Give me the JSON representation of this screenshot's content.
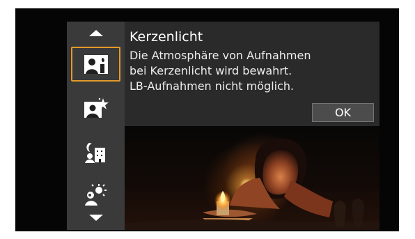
{
  "camera_menu": {
    "mode_title": "Kerzenlicht",
    "description_lines": [
      "Die Atmosphäre von Aufnahmen",
      "bei Kerzenlicht wird bewahrt.",
      "LB-Aufnahmen nicht möglich."
    ],
    "ok_label": "OK",
    "selected_mode": "candlelight"
  },
  "icons": {
    "up": "up-arrow-icon",
    "down": "down-arrow-icon",
    "candlelight": "candlelight-portrait-icon",
    "portrait_star": "portrait-star-icon",
    "night_portrait": "night-portrait-icon",
    "backlight": "backlight-portrait-icon"
  },
  "colors": {
    "selection": "#e39a2c",
    "sidebar": "#3a3a3a",
    "text_panel": "#2a2a2a"
  }
}
